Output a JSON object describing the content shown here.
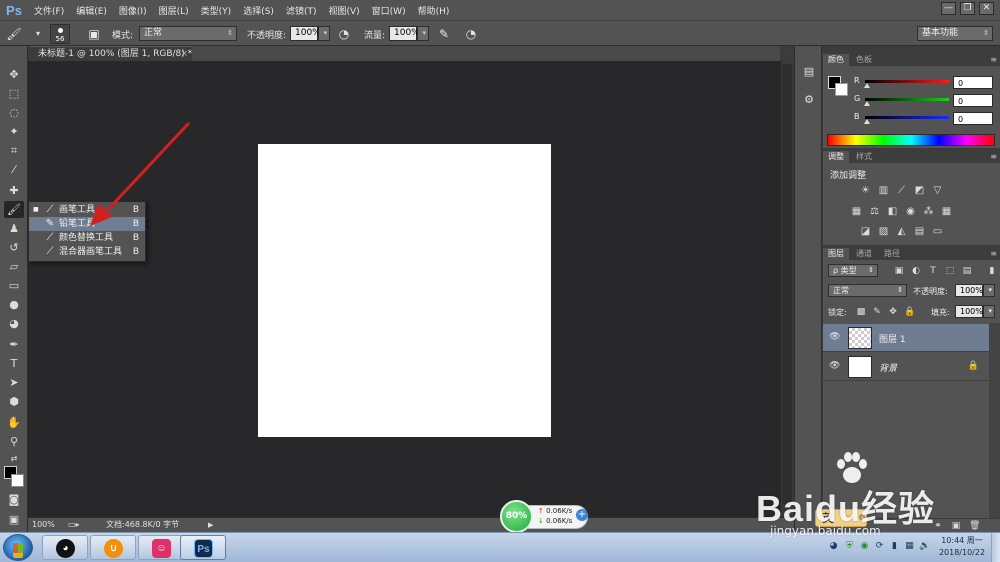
{
  "app": {
    "logo": "Ps"
  },
  "menu": [
    "文件(F)",
    "编辑(E)",
    "图像(I)",
    "图层(L)",
    "类型(Y)",
    "选择(S)",
    "滤镜(T)",
    "视图(V)",
    "窗口(W)",
    "帮助(H)"
  ],
  "window_controls": {
    "minimize": "—",
    "restore": "❐",
    "close": "✕"
  },
  "options": {
    "brush_size": "56",
    "mode_label": "模式:",
    "mode_value": "正常",
    "opacity_label": "不透明度:",
    "opacity_value": "100%",
    "flow_label": "流量:",
    "flow_value": "100%",
    "workspace": "基本功能"
  },
  "document": {
    "tab_title": "未标题-1 @ 100% (图层 1, RGB/8) *",
    "tab_close": "×"
  },
  "status": {
    "zoom": "100%",
    "doc_info": "文档:468.8K/0 字节",
    "arrow": "▶"
  },
  "tools_flyout": [
    {
      "mark": "■",
      "icon": "brush-icon",
      "label": "画笔工具",
      "key": "B",
      "selected": false
    },
    {
      "mark": "",
      "icon": "pencil-icon",
      "label": "铅笔工具",
      "key": "B",
      "selected": true
    },
    {
      "mark": "",
      "icon": "color-replacement-icon",
      "label": "颜色替换工具",
      "key": "B",
      "selected": false
    },
    {
      "mark": "",
      "icon": "mixer-brush-icon",
      "label": "混合器画笔工具",
      "key": "B",
      "selected": false
    }
  ],
  "color_panel": {
    "tabs": [
      "颜色",
      "色板"
    ],
    "channels": [
      {
        "label": "R",
        "value": "0",
        "color": "#d01010"
      },
      {
        "label": "G",
        "value": "0",
        "color": "#10a010"
      },
      {
        "label": "B",
        "value": "0",
        "color": "#1020d0"
      }
    ]
  },
  "adjustments_panel": {
    "tabs": [
      "调整",
      "样式"
    ],
    "title": "添加调整"
  },
  "layers_panel": {
    "tabs": [
      "图层",
      "通道",
      "路径"
    ],
    "filter_kind": "ρ 类型",
    "blend_mode": "正常",
    "opacity_label": "不透明度:",
    "opacity_value": "100%",
    "lock_label": "锁定:",
    "fill_label": "填充:",
    "fill_value": "100%",
    "layers": [
      {
        "name": "图层 1",
        "selected": true,
        "thumb": "transparent",
        "locked": false
      },
      {
        "name": "背景",
        "selected": false,
        "thumb": "white",
        "locked": true
      }
    ]
  },
  "network_widget": {
    "percent": "80%",
    "upload": "0.06K/s",
    "download": "0.06K/s",
    "plus": "+"
  },
  "ime": {
    "lang": "英",
    "dots": "◦ ,  ⚙"
  },
  "watermark": {
    "brand": "Baidu经验",
    "url": "jingyan.baidu.com"
  },
  "taskbar": {
    "apps": [
      {
        "name": "qq",
        "glyph": "🐧",
        "color": "#111"
      },
      {
        "name": "uc-browser",
        "glyph": "⌘",
        "color": "#f2900c"
      },
      {
        "name": "media-player",
        "glyph": "☺",
        "color": "#e0306a"
      },
      {
        "name": "photoshop",
        "glyph": "Ps",
        "color": "#0f2c4e",
        "active": true
      }
    ],
    "clock_time": "10:44 周一",
    "clock_date": "2018/10/22"
  }
}
